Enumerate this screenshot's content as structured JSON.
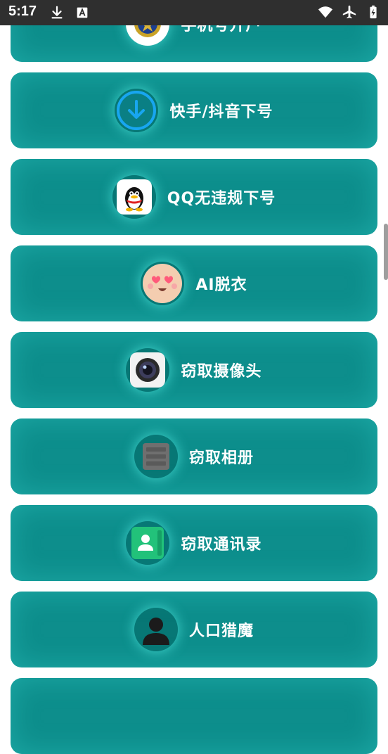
{
  "status_bar": {
    "time": "5:17",
    "left_icons": [
      "download-icon",
      "a-box-icon"
    ],
    "right_icons": [
      "wifi-icon",
      "airplane-icon",
      "battery-charging-icon"
    ]
  },
  "menu_items": [
    {
      "label": "手机号开户",
      "icon": "police-badge-icon"
    },
    {
      "label": "快手/抖音下号",
      "icon": "download-circle-icon"
    },
    {
      "label": "QQ无违规下号",
      "icon": "qq-penguin-icon"
    },
    {
      "label": "AI脱衣",
      "icon": "heart-eyes-face-icon"
    },
    {
      "label": "窃取摄像头",
      "icon": "camera-icon"
    },
    {
      "label": "窃取相册",
      "icon": "photo-album-icon"
    },
    {
      "label": "窃取通讯录",
      "icon": "contacts-icon"
    },
    {
      "label": "人口猎魔",
      "icon": "person-silhouette-icon"
    }
  ],
  "colors": {
    "card_bg": "#0d8e8c",
    "status_bar_bg": "#2f2f2f",
    "label_text": "#ffffff"
  }
}
